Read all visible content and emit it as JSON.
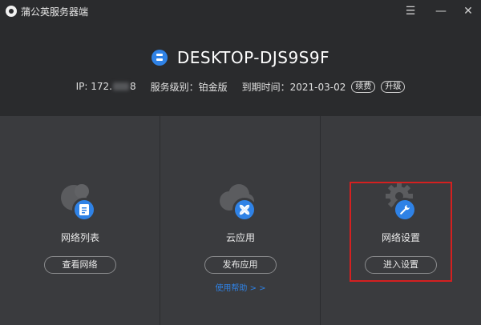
{
  "app": {
    "title": "蒲公英服务器端",
    "window_controls": {
      "menu": "☰",
      "minimize": "—",
      "close": "✕"
    }
  },
  "header": {
    "hostname": "DESKTOP-DJS9S9F",
    "ip_label": "IP: 172.",
    "ip_tail": "8",
    "service_level": "服务级别：铂金版",
    "expiry": "到期时间：2021-03-02",
    "renew_label": "续费",
    "upgrade_label": "升级"
  },
  "panels": [
    {
      "label": "网络列表",
      "button": "查看网络",
      "icon": "list-icon"
    },
    {
      "label": "云应用",
      "button": "发布应用",
      "link": "使用帮助 > >",
      "icon": "cloud-apps-icon"
    },
    {
      "label": "网络设置",
      "button": "进入设置",
      "icon": "wrench-icon"
    }
  ],
  "colors": {
    "accent": "#2f82e6",
    "highlight": "#d42020",
    "header_bg": "#2a2b2d",
    "panel_bg": "#3a3b3e"
  }
}
